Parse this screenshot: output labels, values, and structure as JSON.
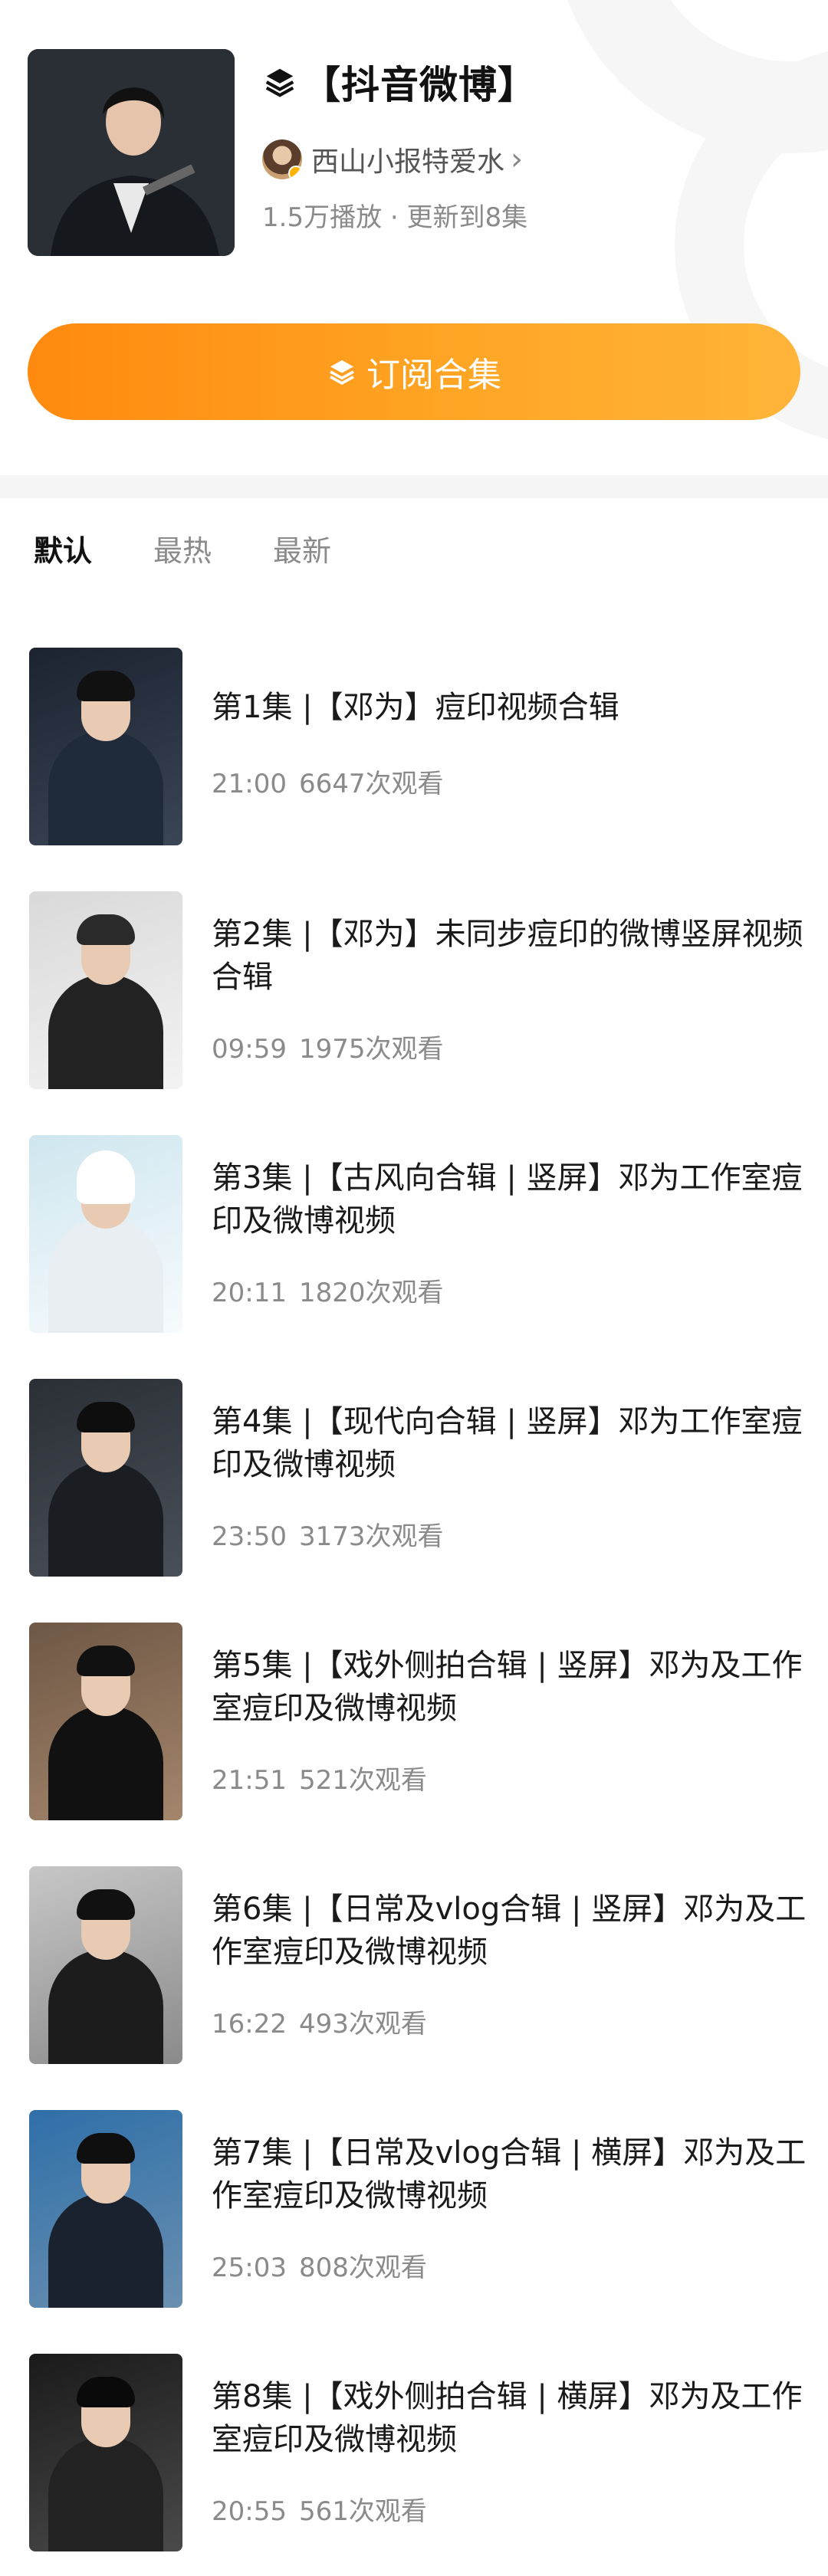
{
  "collection": {
    "title": "【抖音微博】",
    "author": "西山小报特爱水",
    "stats": "1.5万播放 · 更新到8集",
    "subscribe_label": "订阅合集"
  },
  "tabs": [
    {
      "label": "默认",
      "active": true
    },
    {
      "label": "最热",
      "active": false
    },
    {
      "label": "最新",
      "active": false
    }
  ],
  "episodes": [
    {
      "title": "第1集 |【邓为】痘印视频合辑",
      "duration": "21:00",
      "views": "6647次观看"
    },
    {
      "title": "第2集 |【邓为】未同步痘印的微博竖屏视频合辑",
      "duration": "09:59",
      "views": "1975次观看"
    },
    {
      "title": "第3集 |【古风向合辑 | 竖屏】邓为工作室痘印及微博视频",
      "duration": "20:11",
      "views": "1820次观看"
    },
    {
      "title": "第4集 |【现代向合辑 | 竖屏】邓为工作室痘印及微博视频",
      "duration": "23:50",
      "views": "3173次观看"
    },
    {
      "title": "第5集 |【戏外侧拍合辑 | 竖屏】邓为及工作室痘印及微博视频",
      "duration": "21:51",
      "views": "521次观看"
    },
    {
      "title": "第6集 |【日常及vlog合辑 | 竖屏】邓为及工作室痘印及微博视频",
      "duration": "16:22",
      "views": "493次观看"
    },
    {
      "title": "第7集 |【日常及vlog合辑 | 横屏】邓为及工作室痘印及微博视频",
      "duration": "25:03",
      "views": "808次观看"
    },
    {
      "title": "第8集 |【戏外侧拍合辑 | 横屏】邓为及工作室痘印及微博视频",
      "duration": "20:55",
      "views": "561次观看"
    }
  ],
  "colors": {
    "accent": "#ff9a1f",
    "text_primary": "#1a1a1a",
    "text_secondary": "#8a8a8a"
  },
  "icons": {
    "collection": "layers-icon",
    "author_link": "chevron-right-icon"
  }
}
